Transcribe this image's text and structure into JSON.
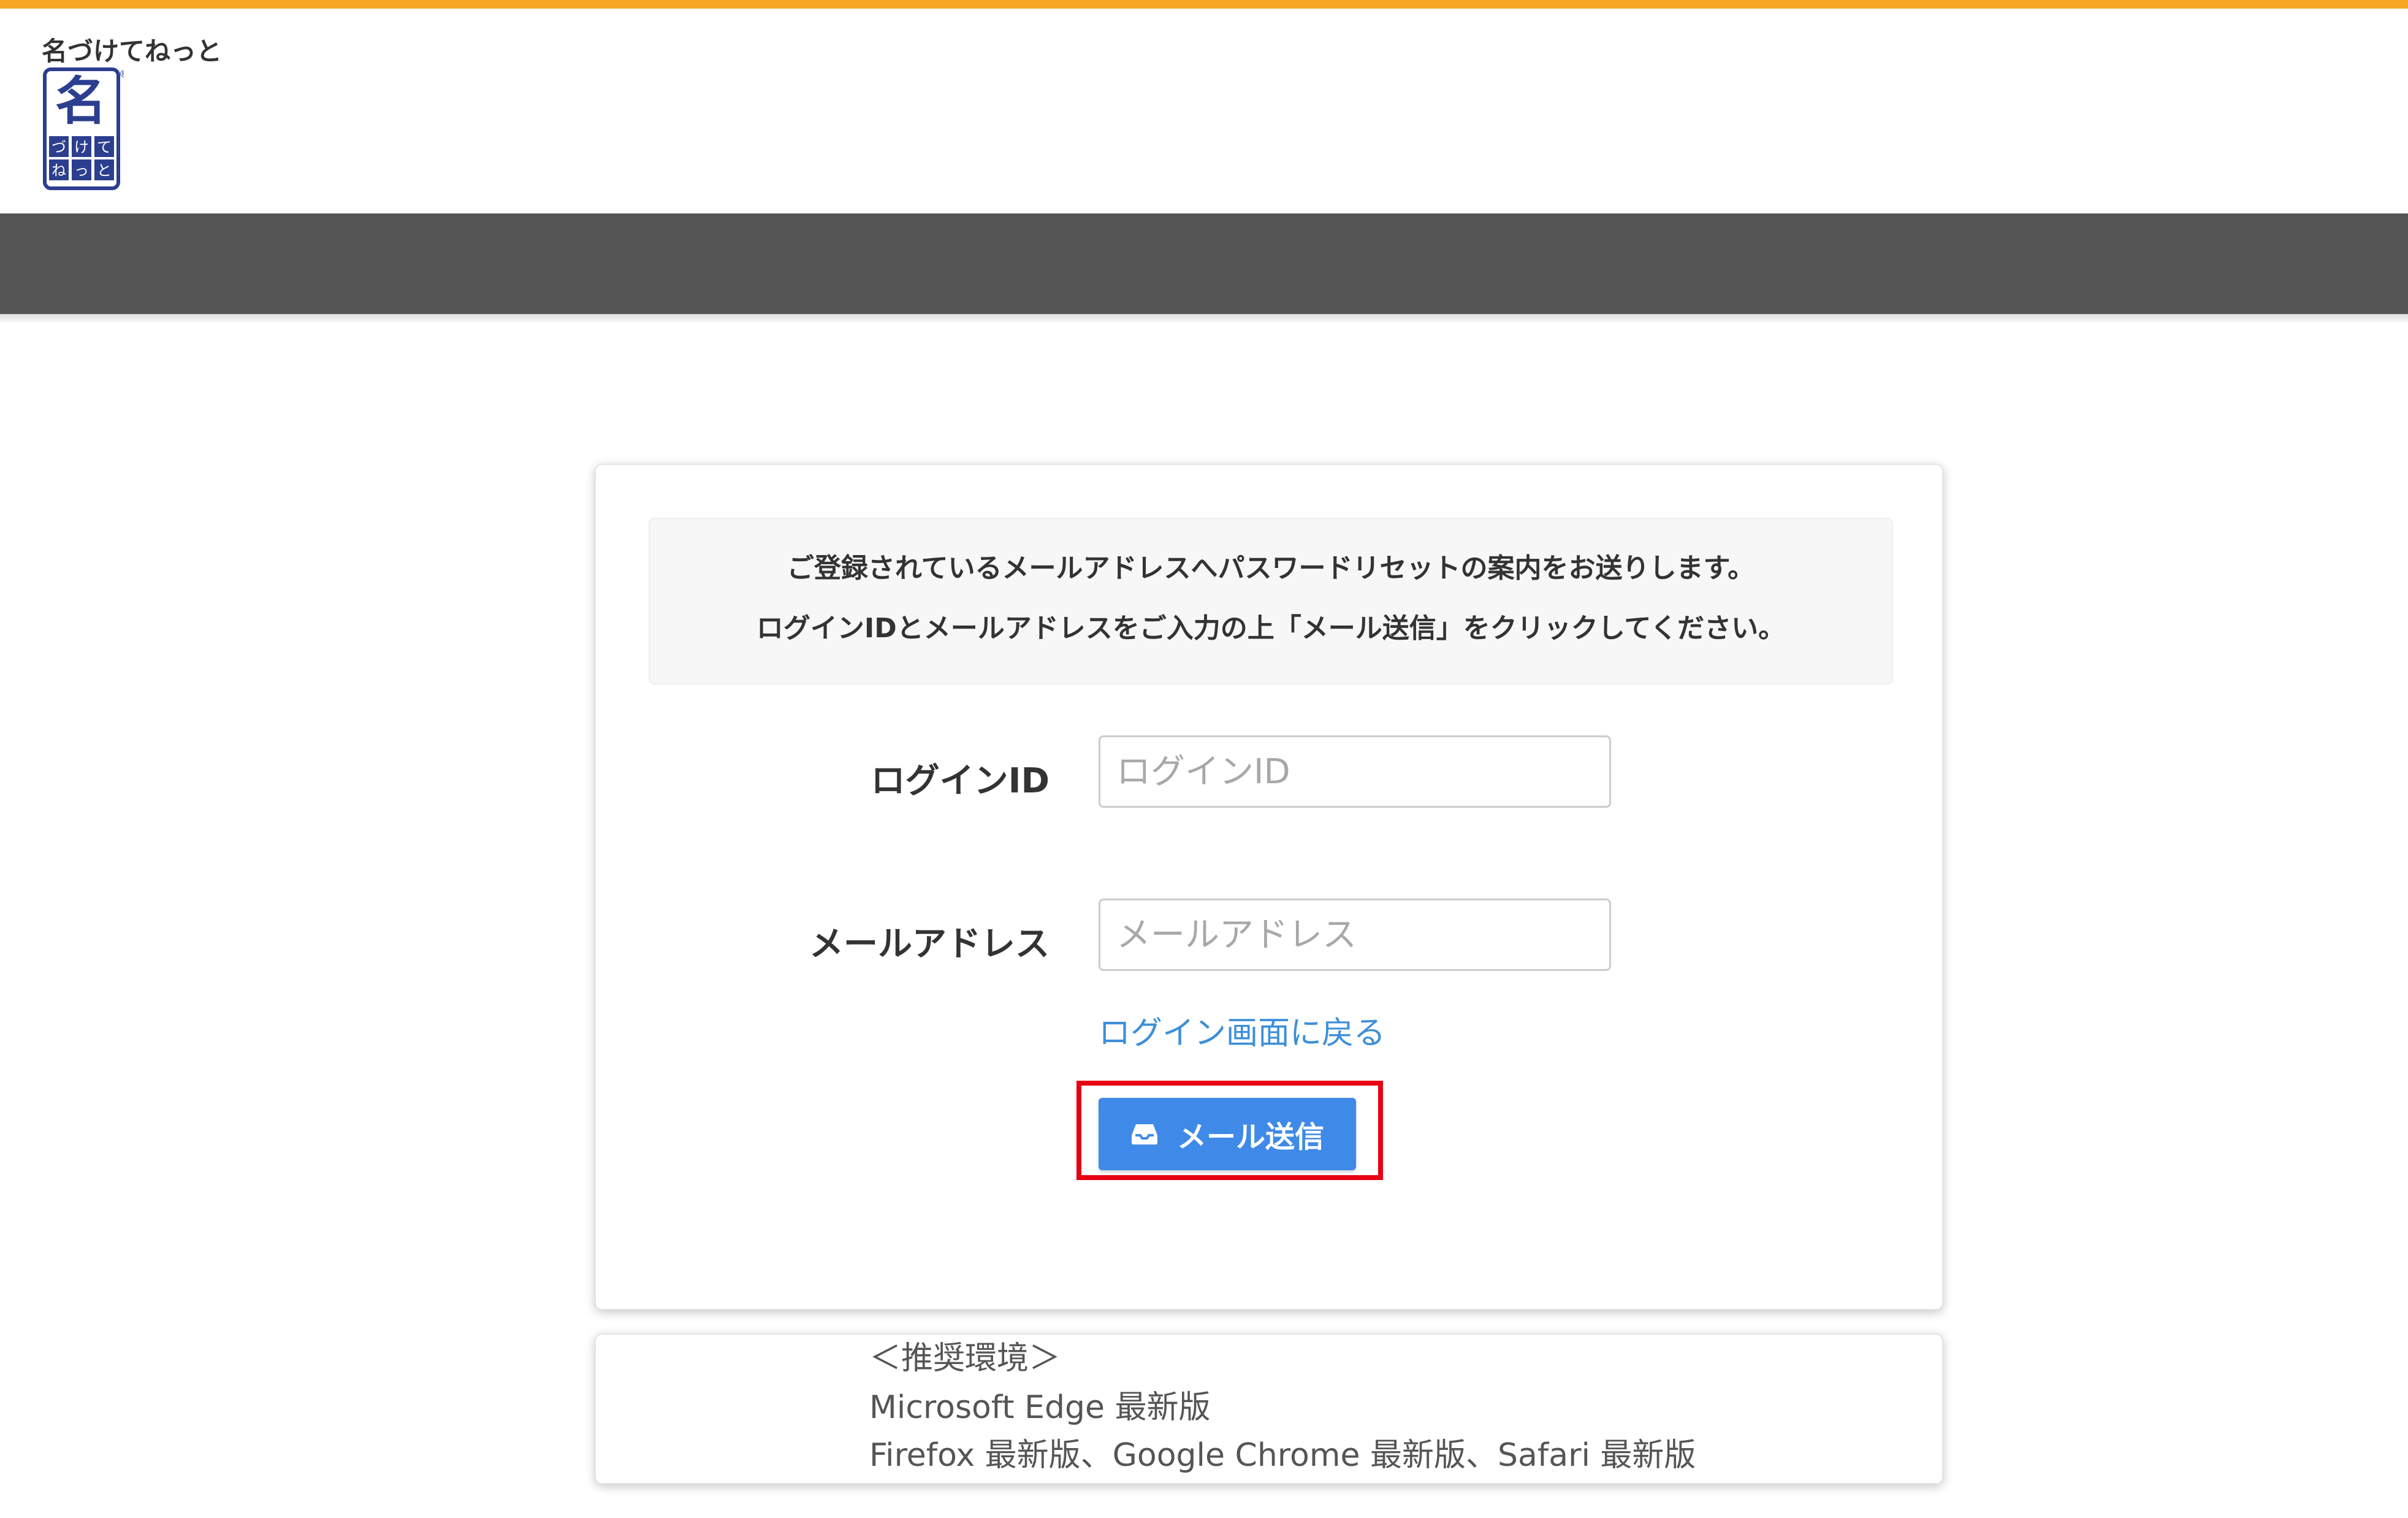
{
  "colors": {
    "top_strip": "#f5a623",
    "nav_bar": "#555555",
    "primary_button": "#3f8ae8",
    "link": "#3d8fd8",
    "highlight": "#e60012",
    "logo_blue": "#2c3e8f"
  },
  "header": {
    "brand_name": "名づけてねっと",
    "logo": {
      "main_char": "名",
      "grid_chars": [
        "づ",
        "け",
        "て",
        "ね",
        "っ",
        "と"
      ],
      "registered": "®"
    }
  },
  "form": {
    "notice_lines": [
      "ご登録されているメールアドレスへパスワードリセットの案内をお送りします。",
      "ログインIDとメールアドレスをご入力の上「メール送信」をクリックしてください。"
    ],
    "login_id": {
      "label": "ログインID",
      "placeholder": "ログインID",
      "value": ""
    },
    "email": {
      "label": "メールアドレス",
      "placeholder": "メールアドレス",
      "value": ""
    },
    "back_link": "ログイン画面に戻る",
    "send_button": {
      "label": "メール送信",
      "icon": "inbox-icon"
    }
  },
  "environment": {
    "title": "＜推奨環境＞",
    "lines": [
      "Microsoft Edge 最新版",
      "Firefox 最新版、Google Chrome 最新版、Safari 最新版"
    ]
  }
}
